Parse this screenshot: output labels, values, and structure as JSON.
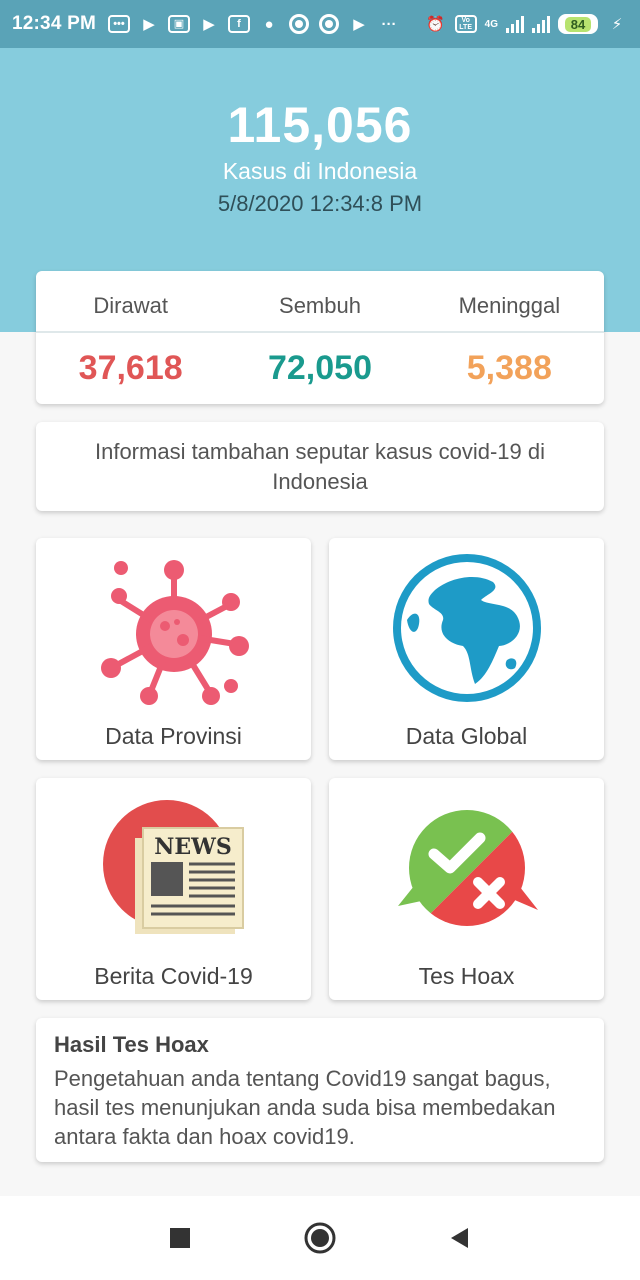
{
  "status_bar": {
    "time": "12:34 PM",
    "dots": "···",
    "network": "4G",
    "volte": "Vo LTE",
    "battery": "84",
    "icons": [
      "message-icon",
      "play-icon",
      "photo-icon",
      "play-icon",
      "facebook-icon",
      "messenger-icon",
      "circle-icon",
      "circle-icon",
      "youtube-icon",
      "alarm-icon",
      "signal-icon",
      "charging-icon"
    ]
  },
  "header": {
    "total": "115,056",
    "subtitle": "Kasus di Indonesia",
    "date": "5/8/2020 12:34:8 PM",
    "bg_color": "#86ccdd"
  },
  "stats": {
    "columns": [
      {
        "label": "Dirawat",
        "value": "37,618",
        "color": "#e05656"
      },
      {
        "label": "Sembuh",
        "value": "72,050",
        "color": "#1a9a8e"
      },
      {
        "label": "Meninggal",
        "value": "5,388",
        "color": "#f2a25a"
      }
    ]
  },
  "info": {
    "text": "Informasi tambahan seputar kasus covid-19 di Indonesia"
  },
  "tiles": [
    {
      "label": "Data Provinsi",
      "icon": "virus-icon"
    },
    {
      "label": "Data Global",
      "icon": "globe-icon"
    },
    {
      "label": "Berita Covid-19",
      "icon": "newspaper-icon",
      "icon_text": "NEWS"
    },
    {
      "label": "Tes Hoax",
      "icon": "check-cross-icon"
    }
  ],
  "result": {
    "title": "Hasil Tes Hoax",
    "body": "Pengetahuan anda tentang Covid19 sangat bagus, hasil tes menunjukan anda suda bisa membedakan antara fakta dan hoax covid19."
  },
  "navbar": {
    "icons": [
      "recents-icon",
      "home-icon",
      "back-icon"
    ]
  }
}
